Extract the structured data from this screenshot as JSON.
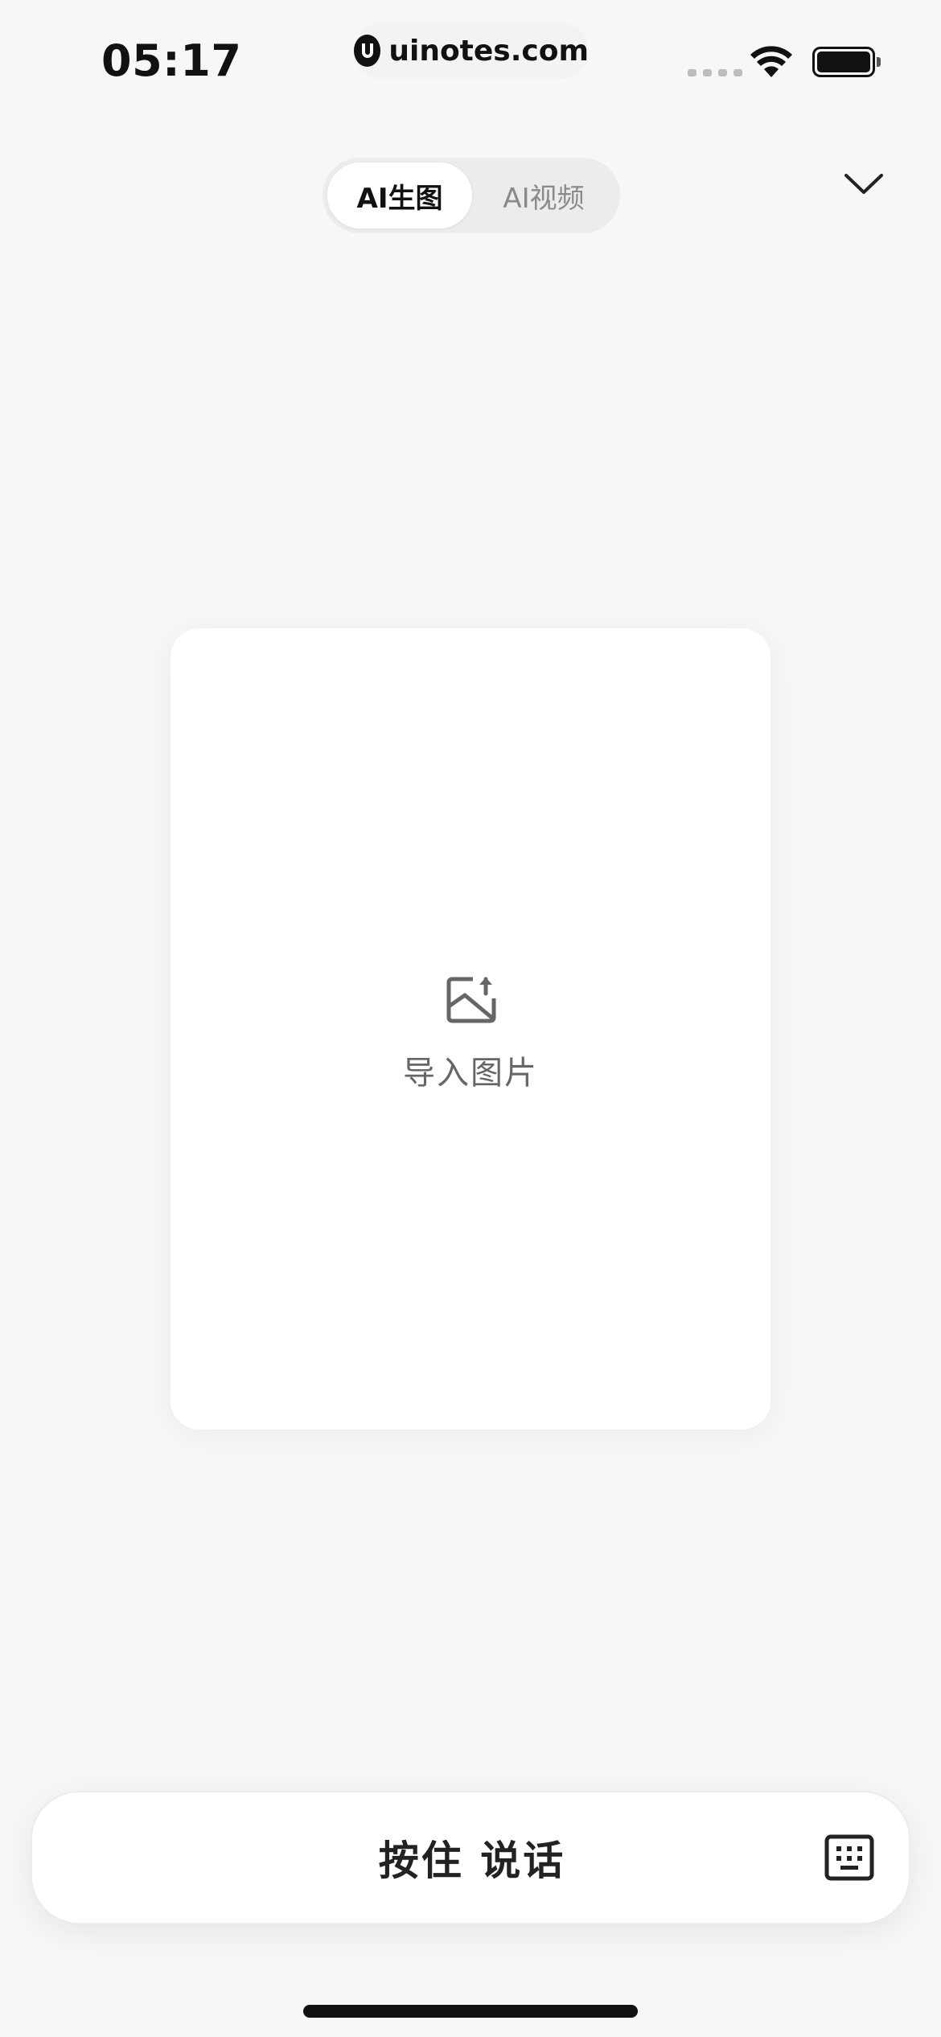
{
  "status_bar": {
    "time": "05:17",
    "site": "uinotes.com"
  },
  "tabs": [
    {
      "label": "AI生图",
      "active": true
    },
    {
      "label": "AI视频",
      "active": false
    }
  ],
  "import_card": {
    "label": "导入图片",
    "icon": "image-upload-icon"
  },
  "voice_bar": {
    "label": "按住 说话",
    "icon": "keyboard-icon"
  },
  "colors": {
    "background": "#f7f7f7",
    "card": "#ffffff",
    "text_primary": "#111111",
    "text_secondary": "#8a8a8a"
  }
}
